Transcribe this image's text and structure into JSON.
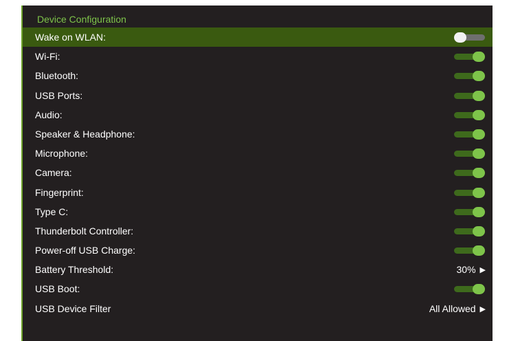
{
  "section_title": "Device Configuration",
  "rows": [
    {
      "label": "Wake on WLAN:",
      "kind": "toggle",
      "on": false,
      "selected": true
    },
    {
      "label": "Wi-Fi:",
      "kind": "toggle",
      "on": true
    },
    {
      "label": "Bluetooth:",
      "kind": "toggle",
      "on": true
    },
    {
      "label": "USB Ports:",
      "kind": "toggle",
      "on": true
    },
    {
      "label": "Audio:",
      "kind": "toggle",
      "on": true
    },
    {
      "label": "Speaker & Headphone:",
      "kind": "toggle",
      "on": true
    },
    {
      "label": "Microphone:",
      "kind": "toggle",
      "on": true
    },
    {
      "label": "Camera:",
      "kind": "toggle",
      "on": true
    },
    {
      "label": "Fingerprint:",
      "kind": "toggle",
      "on": true
    },
    {
      "label": "Type C:",
      "kind": "toggle",
      "on": true
    },
    {
      "label": "Thunderbolt Controller:",
      "kind": "toggle",
      "on": true
    },
    {
      "label": "Power-off USB Charge:",
      "kind": "toggle",
      "on": true
    },
    {
      "label": "Battery Threshold:",
      "kind": "value",
      "value": "30%",
      "icon": "triangle-right-icon"
    },
    {
      "label": "USB Boot:",
      "kind": "toggle",
      "on": true
    },
    {
      "label": "USB Device Filter",
      "kind": "value",
      "value": "All Allowed",
      "icon": "triangle-right-icon"
    }
  ],
  "colors": {
    "panel_background": "#231f20",
    "accent_green": "#7ec44a",
    "selected_row": "#3a5a10",
    "toggle_track_on": "#3e6a1c",
    "toggle_track_off": "#6f6f6f",
    "toggle_knob_off": "#f2f2f2",
    "left_border": "#6da22a"
  }
}
